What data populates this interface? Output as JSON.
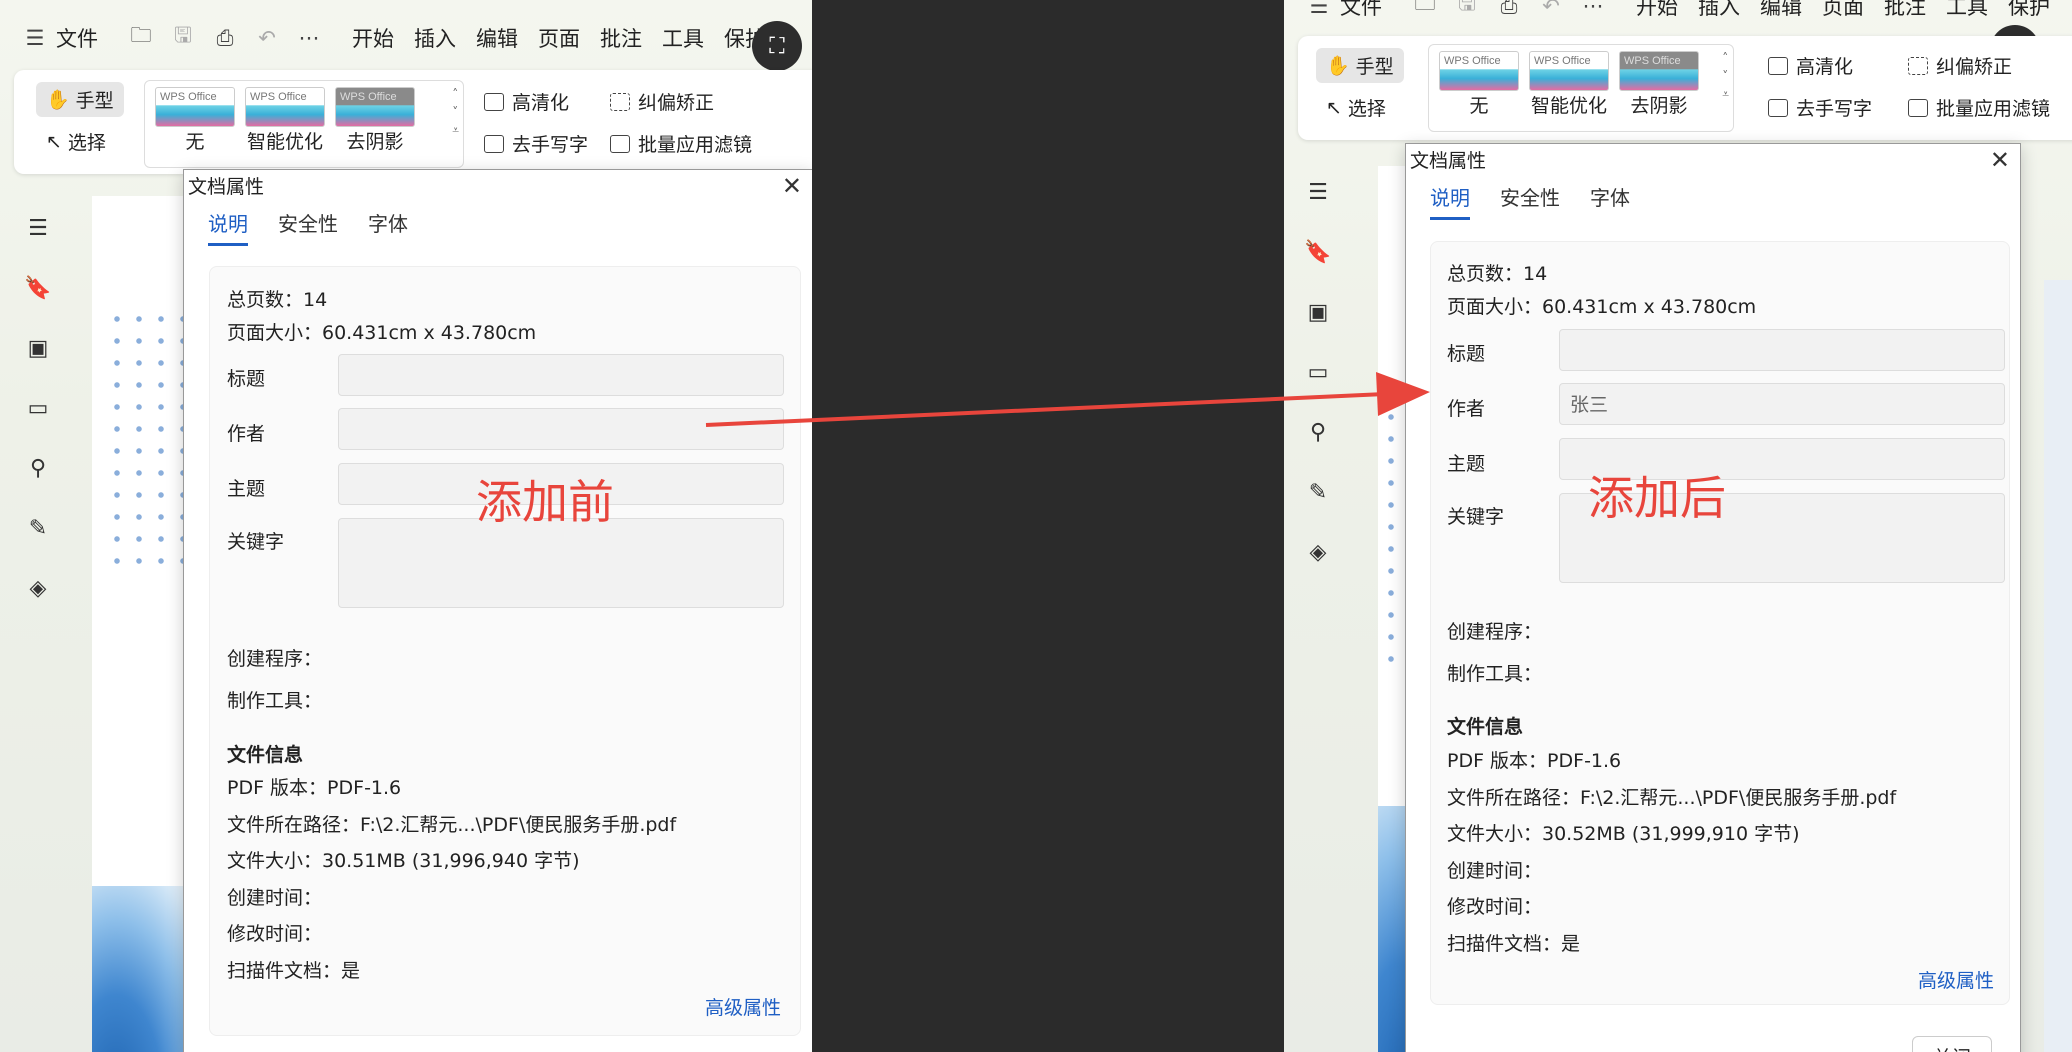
{
  "left": {
    "menu": {
      "file": "文件",
      "items": [
        "开始",
        "插入",
        "编辑",
        "页面",
        "批注",
        "工具",
        "保护"
      ]
    },
    "ribbon": {
      "hand": "手型",
      "select": "选择",
      "thumb_brand": "WPS Office",
      "thumbs": [
        "无",
        "智能优化",
        "去阴影"
      ],
      "hd": "高清化",
      "deskew": "纠偏矫正",
      "remove_handwriting": "去手写字",
      "batch_filter": "批量应用滤镜"
    },
    "dialog": {
      "title": "文档属性",
      "tabs": [
        "说明",
        "安全性",
        "字体"
      ],
      "total_pages": "总页数：14",
      "page_size": "页面大小：60.431cm x 43.780cm",
      "label_title": "标题",
      "label_author": "作者",
      "label_subject": "主题",
      "label_keywords": "关键字",
      "author_value": "",
      "creator": "创建程序：",
      "producer": "制作工具：",
      "file_info": "文件信息",
      "pdf_version": "PDF 版本：PDF-1.6",
      "path": "文件所在路径：F:\\2.汇帮元...\\PDF\\便民服务手册.pdf",
      "size": "文件大小：30.51MB (31,996,940 字节)",
      "created": "创建时间：",
      "modified": "修改时间：",
      "scanned": "扫描件文档：是",
      "advanced": "高级属性"
    },
    "annotation": "添加前"
  },
  "right": {
    "menu": {
      "file": "文件",
      "items": [
        "开始",
        "插入",
        "编辑",
        "页面",
        "批注",
        "工具",
        "保护"
      ]
    },
    "ribbon": {
      "hand": "手型",
      "select": "选择",
      "thumb_brand": "WPS Office",
      "thumbs": [
        "无",
        "智能优化",
        "去阴影"
      ],
      "hd": "高清化",
      "deskew": "纠偏矫正",
      "remove_handwriting": "去手写字",
      "batch_filter": "批量应用滤镜"
    },
    "dialog": {
      "title": "文档属性",
      "tabs": [
        "说明",
        "安全性",
        "字体"
      ],
      "total_pages": "总页数：14",
      "page_size": "页面大小：60.431cm x 43.780cm",
      "label_title": "标题",
      "label_author": "作者",
      "label_subject": "主题",
      "label_keywords": "关键字",
      "author_value": "张三",
      "creator": "创建程序：",
      "producer": "制作工具：",
      "file_info": "文件信息",
      "pdf_version": "PDF 版本：PDF-1.6",
      "path": "文件所在路径：F:\\2.汇帮元...\\PDF\\便民服务手册.pdf",
      "size": "文件大小：30.52MB (31,999,910 字节)",
      "created": "创建时间：",
      "modified": "修改时间：",
      "scanned": "扫描件文档：是",
      "advanced": "高级属性",
      "close_button": "关闭"
    },
    "annotation": "添加后"
  },
  "colors": {
    "accent": "#1f5fc4",
    "annotation": "#e8453c",
    "arrow": "#e8453c"
  }
}
